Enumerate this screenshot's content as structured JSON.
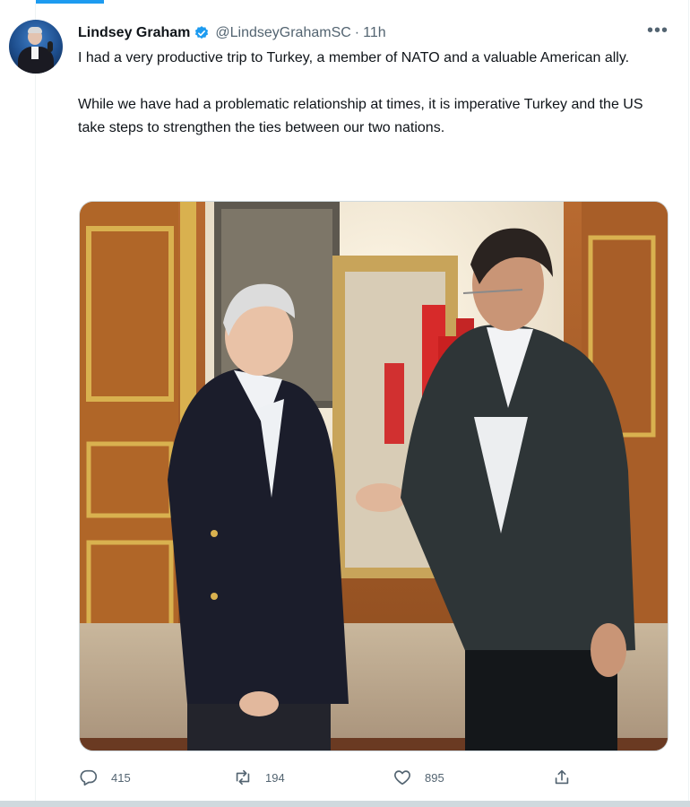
{
  "tweet": {
    "author_name": "Lindsey Graham",
    "handle": "@LindseyGrahamSC",
    "separator": "·",
    "time": "11h",
    "paragraphs": [
      "I had a very productive trip to Turkey, a member of NATO and a valuable American ally.",
      "While we have had a problematic relationship at times, it is imperative Turkey and the US take steps to strengthen the ties between our two nations."
    ],
    "more_label": "•••"
  },
  "actions": {
    "reply_count": "415",
    "retweet_count": "194",
    "like_count": "895"
  },
  "icons": {
    "verified": "verified-badge-icon",
    "more": "more-options-icon",
    "reply": "reply-icon",
    "retweet": "retweet-icon",
    "like": "heart-icon",
    "share": "share-icon"
  },
  "colors": {
    "accent": "#1d9bf0",
    "secondary_text": "#536471",
    "primary_text": "#0f1419"
  }
}
